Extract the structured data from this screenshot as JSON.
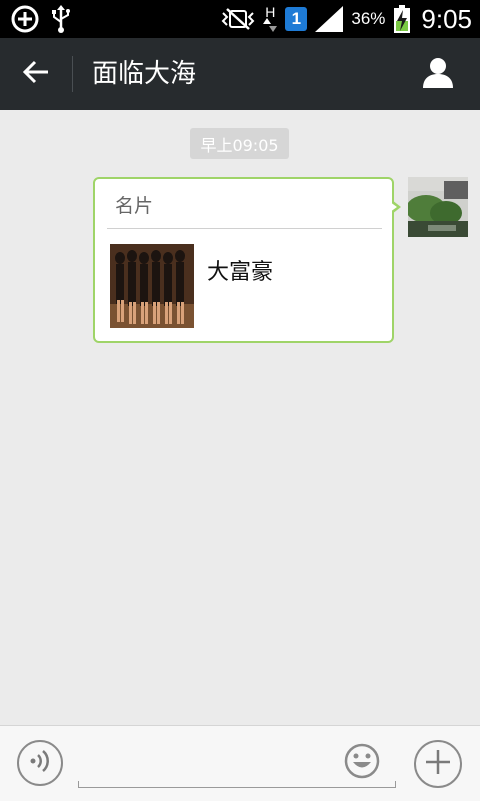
{
  "status_bar": {
    "icons_left": [
      "add-circle-icon",
      "usb-icon"
    ],
    "icons_right": [
      "vibrate-mute-icon",
      "network-h-icon",
      "sim-1-icon",
      "signal-icon",
      "battery-charging-icon"
    ],
    "sim_label": "1",
    "network_label": "H",
    "battery": "36%",
    "time": "9:05",
    "colors": {
      "background": "#000000",
      "sim_badge": "#1e7bd6",
      "battery_charge": "#7ac943"
    }
  },
  "header": {
    "back_icon": "arrow-left-icon",
    "title": "面临大海",
    "contact_icon": "person-icon",
    "background": "#272b2e"
  },
  "chat": {
    "timestamp": "早上09:05",
    "messages": [
      {
        "type": "contact-card",
        "direction": "outgoing",
        "card_label": "名片",
        "contact_name": "大富豪",
        "border_color": "#9fd468"
      }
    ]
  },
  "input_bar": {
    "voice_icon": "voice-icon",
    "emoji_icon": "emoji-icon",
    "plus_icon": "plus-icon",
    "placeholder": ""
  }
}
